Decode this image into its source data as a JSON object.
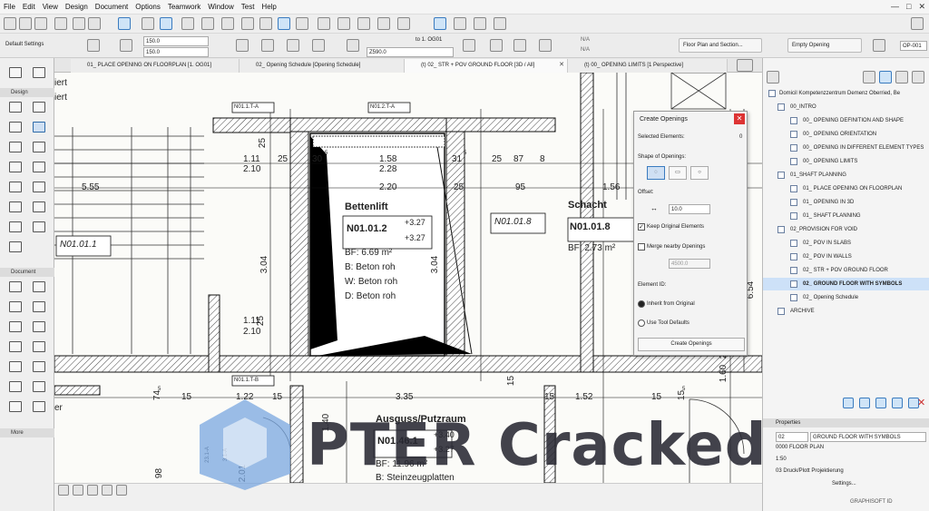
{
  "menu": [
    "File",
    "Edit",
    "View",
    "Design",
    "Document",
    "Options",
    "Teamwork",
    "Window",
    "Test",
    "Help"
  ],
  "toolbar": {
    "default_settings": "Default Settings",
    "height_value_1": "150.0",
    "height_value_2": "150.0",
    "elevation_value": "Z590.0",
    "story_link": "to 1. OG01",
    "na_1": "N/A",
    "na_2": "N/A",
    "floor_plan_button": "Floor Plan and Section...",
    "empty_opening_button": "Empty Opening",
    "id_field": "OP-001"
  },
  "tabs": [
    {
      "label": "01_ PLACE OPENING ON FLOORPLAN [1. OG01]"
    },
    {
      "label": "02_ Opening Schedule [Opening Schedule]"
    },
    {
      "label": "(t) 02_ STR + POV GROUND FLOOR [3D / All]"
    },
    {
      "label": "(t) 00_ OPENING LIMITS [1 Perspective]"
    }
  ],
  "left_panel": {
    "design_header": "Design",
    "document_header": "Document",
    "more_header": "More"
  },
  "canvas": {
    "left_text_1": "iert",
    "left_text_2": "iert",
    "left_text_3": "er",
    "tags": [
      "N01.1.T-A",
      "N01.2.T-A",
      "N01.1.T-B"
    ],
    "dims": [
      "25",
      "1.11",
      "2.10",
      "25",
      "30",
      "5",
      "1.58",
      "31",
      "5",
      "25",
      "87",
      "8",
      "2.28",
      "5.55",
      "2.20",
      "25",
      "95",
      "1.56",
      "3.04",
      "3.04",
      "25",
      "1.11",
      "2.10",
      "15",
      "1.22",
      "15",
      "3.35",
      "15",
      "1.52",
      "15",
      "1.60",
      "2.20",
      "6.54",
      "1.40",
      "98",
      "2.01",
      "74",
      "5",
      "15",
      "15",
      "5"
    ],
    "rooms": [
      {
        "name": "Bettenlift",
        "id": "N01.01.2",
        "h1": "+3.27",
        "h2": "+3.27",
        "area": "BF: 6.69 m²",
        "b": "B: Beton roh",
        "w": "W: Beton roh",
        "d": "D: Beton roh"
      },
      {
        "name": "Schacht",
        "id": "N01.01.8",
        "area": "BF: 2.73 m²"
      },
      {
        "name": "Ausguss/Putzraum",
        "id": "N01.46.1",
        "h1": "+3.40",
        "h2": "+3.27",
        "area": "BF: 11.96 m²",
        "b": "B: Steinzeugplatten"
      }
    ],
    "room_stamps": [
      "N01.01.1",
      "N01.01.8"
    ],
    "vert_tags": [
      "23.1-A",
      "3.1-A"
    ]
  },
  "navigator": {
    "root": "Domicil Kompetenzzentrum Demenz Oberried, Be",
    "items": [
      {
        "label": "00_INTRO"
      },
      {
        "label": "00_ OPENING DEFINITION AND SHAPE"
      },
      {
        "label": "00_ OPENING ORIENTATION"
      },
      {
        "label": "00_ OPENING IN DIFFERENT ELEMENT TYPES"
      },
      {
        "label": "00_ OPENING LIMITS"
      },
      {
        "label": "01_SHAFT PLANNING"
      },
      {
        "label": "01_ PLACE OPENING ON FLOORPLAN"
      },
      {
        "label": "01_ OPENING IN 3D"
      },
      {
        "label": "01_ SHAFT PLANNING"
      },
      {
        "label": "02_PROVISION FOR VOID"
      },
      {
        "label": "02_ POV IN SLABS"
      },
      {
        "label": "02_ POV IN WALLS"
      },
      {
        "label": "02_ STR + POV GROUND FLOOR"
      },
      {
        "label": "02_ GROUND FLOOR WITH SYMBOLS"
      },
      {
        "label": "02_ Opening Schedule"
      },
      {
        "label": "ARCHIVE"
      }
    ],
    "properties_header": "Properties",
    "prop_number": "02",
    "prop_name": "GROUND FLOOR WITH SYMBOLS",
    "prop_row_1": "0000 FLOOR PLAN",
    "prop_row_2": "1:50",
    "prop_row_3": "03 Druck/Plott Projektierung",
    "settings": "Settings...",
    "graphisoft": "GRAPHISOFT ID"
  },
  "dialog": {
    "title": "Create Openings",
    "selected_label": "Selected Elements:",
    "selected_count": "0",
    "shape_label": "Shape of Openings:",
    "offset_label": "Offset:",
    "offset_value": "10.0",
    "keep_label": "Keep Original Elements",
    "merge_label": "Merge nearby Openings",
    "merge_value": "4500.0",
    "element_id_label": "Element ID:",
    "inherit_label": "Inherit from Original",
    "use_tool_label": "Use Tool Defaults",
    "create_button": "Create Openings"
  },
  "watermark": "PTER Cracked",
  "colors": {
    "accent": "#3a7bbf",
    "selected": "#cde1f8",
    "watermark_blue": "#7aa7e0"
  }
}
